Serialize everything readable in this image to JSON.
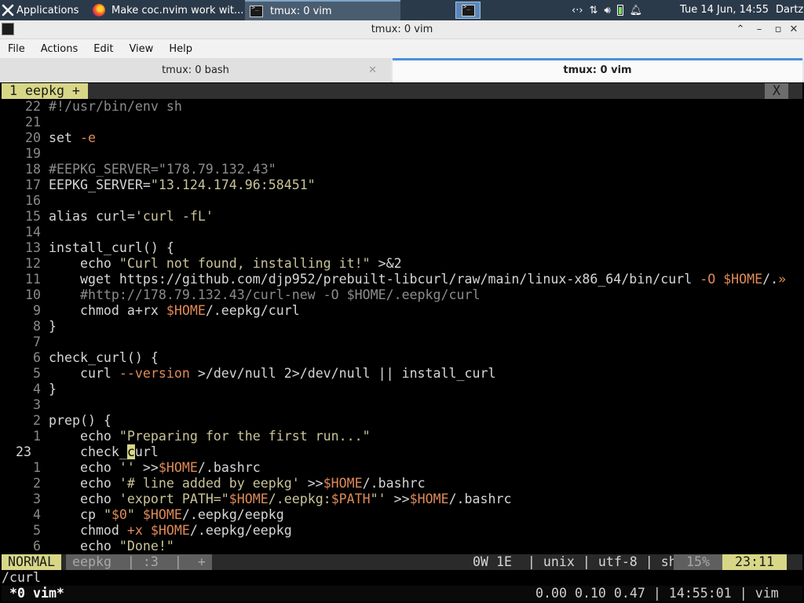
{
  "panel": {
    "applications_label": "Applications",
    "tasks": [
      {
        "label": "Make coc.nvim work wit..."
      },
      {
        "label": "tmux: 0 vim"
      }
    ],
    "clock": "Tue 14 Jun, 14:55",
    "user": "Dartz",
    "tray_icons": [
      "network-icon",
      "transfer-icon",
      "volume-icon",
      "battery-icon",
      "notification-bell-icon"
    ]
  },
  "window": {
    "title": "tmux: 0 vim",
    "menu": [
      "File",
      "Actions",
      "Edit",
      "View",
      "Help"
    ],
    "tabs": [
      {
        "label": "tmux: 0 bash",
        "active": false
      },
      {
        "label": "tmux: 0 vim",
        "active": true
      }
    ]
  },
  "vim": {
    "tabline": {
      "tab": "1 eepkg +",
      "close": "X"
    },
    "lines": [
      {
        "n": "22",
        "text": "#!/usr/bin/env sh"
      },
      {
        "n": "21",
        "text": ""
      },
      {
        "n": "20",
        "text": "set -e"
      },
      {
        "n": "19",
        "text": ""
      },
      {
        "n": "18",
        "text": "#EEPKG_SERVER=\"178.79.132.43\""
      },
      {
        "n": "17",
        "text": "EEPKG_SERVER=\"13.124.174.96:58451\""
      },
      {
        "n": "16",
        "text": ""
      },
      {
        "n": "15",
        "text": "alias curl='curl -fL'"
      },
      {
        "n": "14",
        "text": ""
      },
      {
        "n": "13",
        "text": "install_curl() {"
      },
      {
        "n": "12",
        "text": "    echo \"Curl not found, installing it!\" >&2"
      },
      {
        "n": "11",
        "text": "    wget https://github.com/djp952/prebuilt-libcurl/raw/main/linux-x86_64/bin/curl -O $HOME/.»"
      },
      {
        "n": "10",
        "text": "    #http://178.79.132.43/curl-new -O $HOME/.eepkg/curl"
      },
      {
        "n": "9",
        "text": "    chmod a+rx $HOME/.eepkg/curl"
      },
      {
        "n": "8",
        "text": "}"
      },
      {
        "n": "7",
        "text": ""
      },
      {
        "n": "6",
        "text": "check_curl() {"
      },
      {
        "n": "5",
        "text": "    curl --version >/dev/null 2>/dev/null || install_curl"
      },
      {
        "n": "4",
        "text": "}"
      },
      {
        "n": "3",
        "text": ""
      },
      {
        "n": "2",
        "text": "prep() {"
      },
      {
        "n": "1",
        "text": "    echo \"Preparing for the first run...\""
      },
      {
        "n": "23",
        "text": "    check_curl",
        "current": true
      },
      {
        "n": "1",
        "text": "    echo '' >>$HOME/.bashrc"
      },
      {
        "n": "2",
        "text": "    echo '# line added by eepkg' >>$HOME/.bashrc"
      },
      {
        "n": "3",
        "text": "    echo 'export PATH=\"$HOME/.eepkg:$PATH\"' >>$HOME/.bashrc"
      },
      {
        "n": "4",
        "text": "    cp \"$0\" $HOME/.eepkg/eepkg"
      },
      {
        "n": "5",
        "text": "    chmod +x $HOME/.eepkg/eepkg"
      },
      {
        "n": "6",
        "text": "    echo \"Done!\""
      }
    ],
    "statusline": {
      "mode": "NORMAL",
      "file": "eepkg  | :3  |  +",
      "right": "0W 1E  | unix | utf-8 | sh",
      "percent": "15%",
      "position": "23:11"
    },
    "cmdline": "/curl"
  },
  "tmux": {
    "left": " *0 vim*",
    "right": "0.00 0.10 0.47 | 14:55:01 | vim"
  }
}
